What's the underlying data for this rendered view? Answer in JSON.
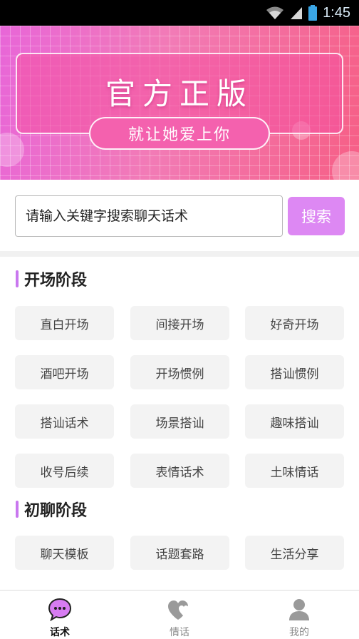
{
  "status_bar": {
    "time": "1:45"
  },
  "banner": {
    "title": "官方正版",
    "slogan": "就让她爱上你"
  },
  "search": {
    "placeholder": "请输入关键字搜索聊天话术",
    "button_label": "搜索"
  },
  "sections": [
    {
      "title": "开场阶段",
      "items": [
        "直白开场",
        "间接开场",
        "好奇开场",
        "酒吧开场",
        "开场惯例",
        "搭讪惯例",
        "搭讪话术",
        "场景搭讪",
        "趣味搭讪",
        "收号后续",
        "表情话术",
        "土味情话"
      ]
    },
    {
      "title": "初聊阶段",
      "items": [
        "聊天模板",
        "话题套路",
        "生活分享"
      ]
    }
  ],
  "tabs": [
    {
      "label": "话术",
      "icon": "chat-bubble-icon",
      "active": true
    },
    {
      "label": "情话",
      "icon": "hearts-icon",
      "active": false
    },
    {
      "label": "我的",
      "icon": "person-icon",
      "active": false
    }
  ],
  "colors": {
    "accent": "#dd88f3",
    "section_bar": "#c977ef",
    "banner_pink": "#f461ae"
  }
}
